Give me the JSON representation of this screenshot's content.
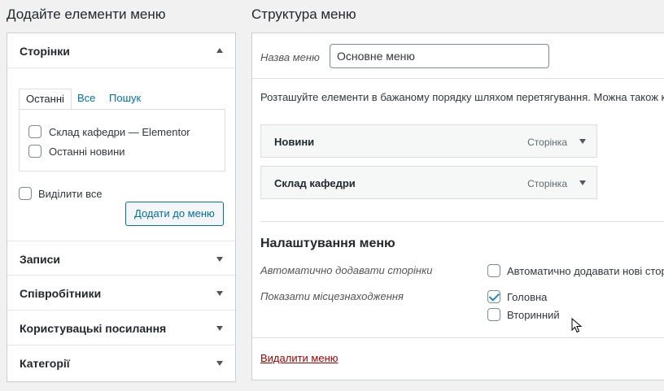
{
  "left": {
    "heading": "Додайте елементи меню",
    "pages_section": {
      "title": "Сторінки",
      "tabs": [
        "Останні",
        "Все",
        "Пошук"
      ],
      "items": [
        {
          "label": "Склад кафедри — Elementor",
          "checked": false
        },
        {
          "label": "Останні новини",
          "checked": false
        }
      ],
      "select_all": "Виділити все",
      "add_button": "Додати до меню"
    },
    "collapsed_sections": [
      "Записи",
      "Співробітники",
      "Користувацькі посилання",
      "Категорії"
    ]
  },
  "right": {
    "heading": "Структура меню",
    "menu_name_label": "Назва меню",
    "menu_name_value": "Основне меню",
    "instructions": "Розташуйте елементи в бажаному порядку шляхом перетягування. Можна також кл",
    "menu_items": [
      {
        "title": "Новини",
        "type": "Сторінка"
      },
      {
        "title": "Склад кафедри",
        "type": "Сторінка"
      }
    ],
    "settings": {
      "title": "Налаштування меню",
      "auto_add_label": "Автоматично додавати сторінки",
      "auto_add_option": "Автоматично додавати нові стор",
      "location_label": "Показати місцезнаходження",
      "locations": [
        {
          "label": "Головна",
          "checked": true
        },
        {
          "label": "Вторинний",
          "checked": false
        }
      ]
    },
    "delete_link": "Видалити меню"
  }
}
